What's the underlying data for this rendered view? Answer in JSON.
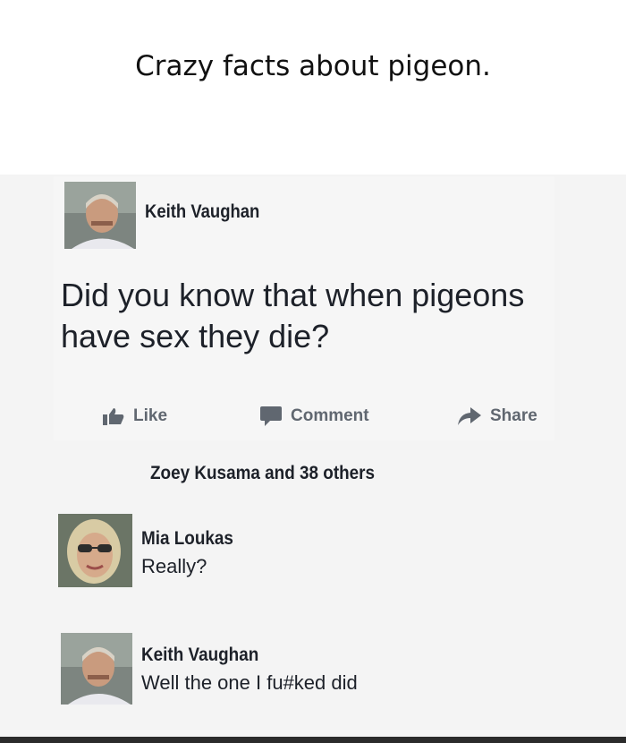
{
  "caption": "Crazy facts about pigeon.",
  "post": {
    "author": "Keith Vaughan",
    "text": "Did you know that when pigeons have sex they die?",
    "actions": {
      "like": "Like",
      "comment": "Comment",
      "share": "Share"
    },
    "reactions": "Zoey Kusama  and 38 others"
  },
  "comments": [
    {
      "author": "Mia Loukas",
      "text": "Really?"
    },
    {
      "author": "Keith Vaughan",
      "text": "Well the one I fu#ked did"
    }
  ],
  "colors": {
    "text": "#1d2129",
    "action": "#606770",
    "background": "#f4f4f4"
  }
}
